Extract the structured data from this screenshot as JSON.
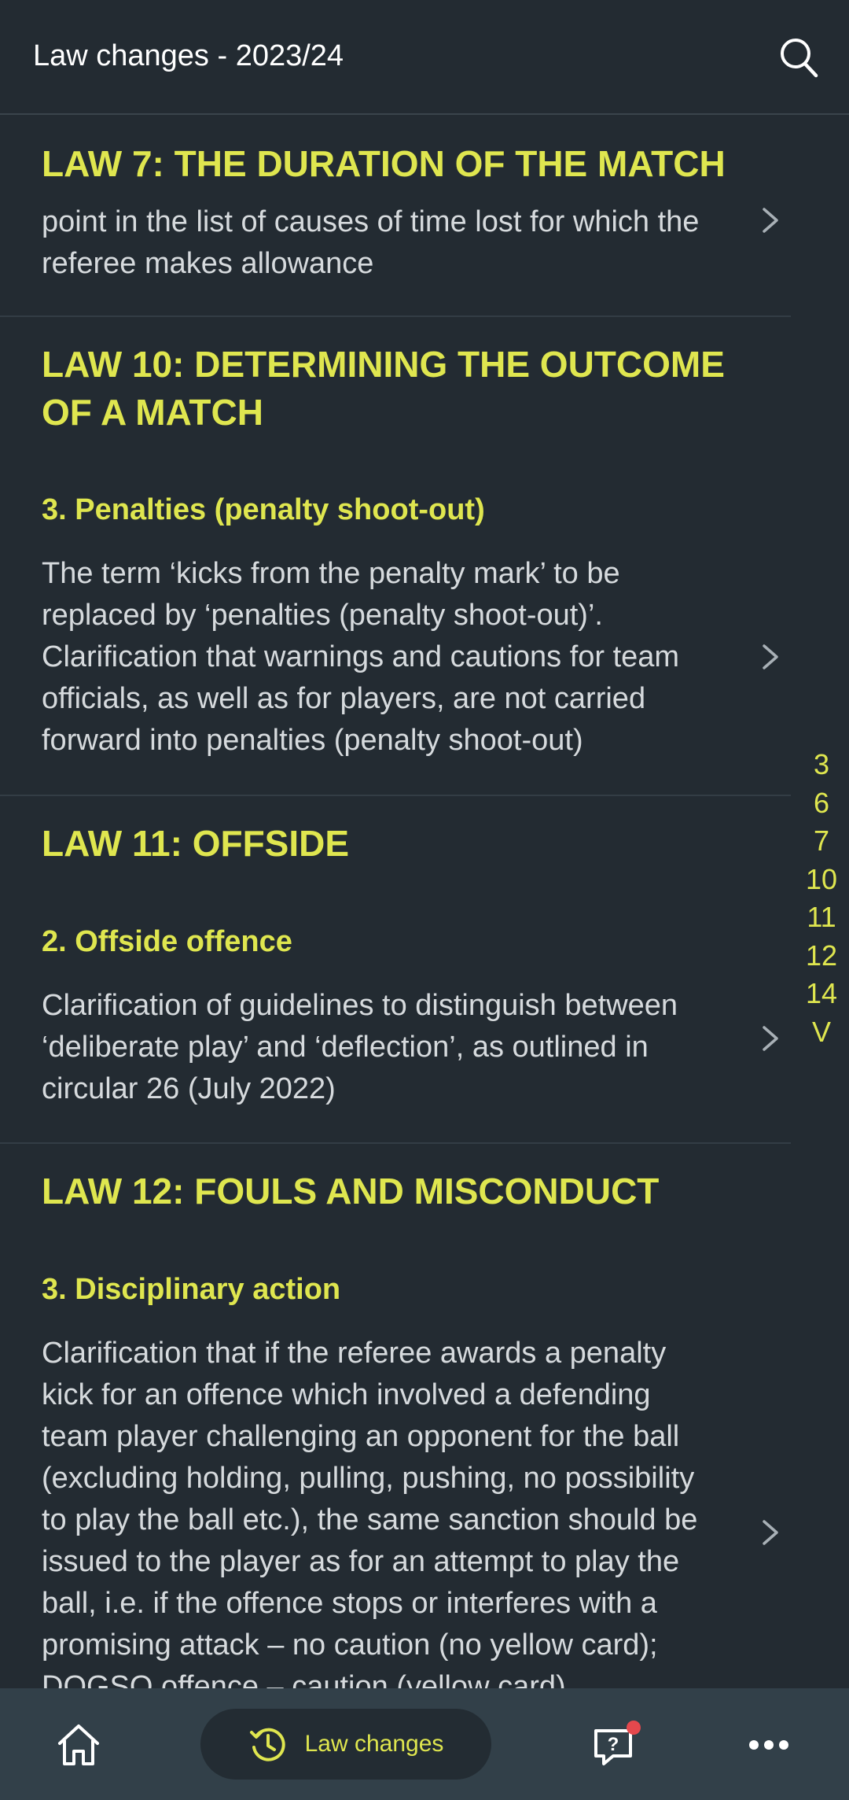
{
  "header": {
    "title": "Law changes - 2023/24"
  },
  "laws": [
    {
      "title": "LAW 7: THE DURATION OF THE MATCH",
      "body": "point in the list of causes of time lost for which the referee makes allowance"
    },
    {
      "title": "LAW 10: DETERMINING THE OUTCOME OF A MATCH",
      "subtitle": "3. Penalties (penalty shoot-out)",
      "body": "The term ‘kicks from the penalty mark’ to be replaced by ‘penalties (penalty shoot-out)’. Clarification that warnings and cautions for team officials, as well as for players, are not carried forward into penalties (penalty shoot-out)"
    },
    {
      "title": "LAW 11: OFFSIDE",
      "subtitle": "2. Offside offence",
      "body": "Clarification of guidelines to distinguish between ‘deliberate play’ and ‘deflection’, as outlined in circular 26 (July 2022)"
    },
    {
      "title": "LAW 12: FOULS AND MISCONDUCT",
      "subtitle": "3. Disciplinary action",
      "body": "Clarification that if the referee awards a penalty kick for an offence which involved a defending team player challenging an opponent for the ball (excluding holding, pulling, pushing, no possibility to play the ball etc.), the same sanction should be issued to the player as for an attempt to play the ball, i.e. if the offence stops or interferes with a promising attack – no caution (no yellow card); DOGSO offence – caution (yellow card)"
    }
  ],
  "index": [
    "3",
    "6",
    "7",
    "10",
    "11",
    "12",
    "14",
    "V"
  ],
  "nav": {
    "active_label": "Law changes"
  },
  "colors": {
    "background": "#232b32",
    "accent": "#dfe64f",
    "nav_background": "#324049",
    "notification": "#e5484d"
  },
  "icons": [
    "search-icon",
    "chevron-right-icon",
    "home-icon",
    "history-icon",
    "faq-icon",
    "more-icon"
  ]
}
